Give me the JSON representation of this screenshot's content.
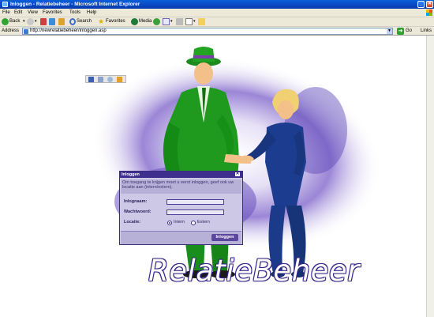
{
  "window": {
    "title": "Inloggen - Relatiebeheer - Microsoft Internet Explorer"
  },
  "menu": {
    "items": [
      "File",
      "Edit",
      "View",
      "Favorites",
      "Tools",
      "Help"
    ]
  },
  "toolbar": {
    "back": "Back",
    "search": "Search",
    "favorites": "Favorites",
    "media": "Media"
  },
  "address": {
    "label": "Address",
    "url": "http://newrelatiebeheer/inloggen.asp",
    "go": "Go",
    "links": "Links"
  },
  "dialog": {
    "title": "Inloggen",
    "close": "✕",
    "info": "Om toegang te krijgen moet u eerst inloggen, geef ook uw locatie aan (intern/extern).",
    "username_label": "Inlognaam:",
    "username_value": "",
    "password_label": "Wachtwoord:",
    "password_value": "",
    "location_label": "Locatie:",
    "options": [
      "Intern",
      "Extern"
    ],
    "selected": "Intern",
    "submit": "Inloggen"
  },
  "brand": {
    "name": "RelatieBeheer"
  },
  "icons": {
    "app": "ie-icon",
    "back": "back-arrow-icon",
    "forward": "forward-arrow-icon",
    "stop": "stop-icon",
    "refresh": "refresh-icon",
    "home": "home-icon",
    "search": "search-icon",
    "favorites": "star-icon",
    "media": "media-icon",
    "history": "history-icon",
    "mail": "mail-icon",
    "print": "print-icon",
    "edit": "edit-icon",
    "folder": "folder-icon"
  },
  "colors": {
    "titlebar": "#0a47c4",
    "dialog_header": "#3e2f8e",
    "dialog_bg": "#cdc8e6",
    "man_suit": "#1f9a1f",
    "woman_suit": "#1c3d8f"
  }
}
